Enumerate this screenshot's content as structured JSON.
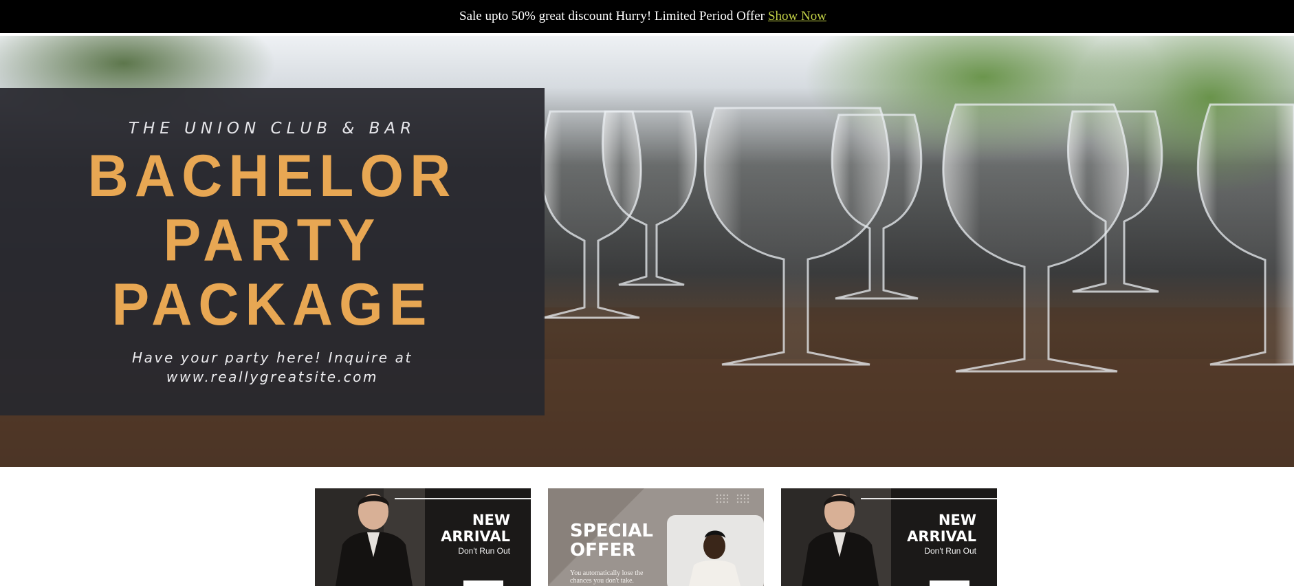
{
  "promo_bar": {
    "message": "Sale upto 50% great discount Hurry! Limited Period Offer",
    "link_label": "Show Now",
    "link_color": "#c2d146"
  },
  "hero": {
    "venue": "THE UNION CLUB & BAR",
    "headline": [
      "BACHELOR",
      "PARTY",
      "PACKAGE"
    ],
    "tagline_line1": "Have your party here! Inquire at",
    "tagline_line2": "www.reallygreatsite.com",
    "accent_color": "#e8a753"
  },
  "cards": [
    {
      "title_line1": "NEW",
      "title_line2": "ARRIVAL",
      "subtitle": "Don't Run Out"
    },
    {
      "title_line1": "SPECIAL",
      "title_line2": "OFFER",
      "subtitle": "You automatically lose the chances you don't take."
    },
    {
      "title_line1": "NEW",
      "title_line2": "ARRIVAL",
      "subtitle": "Don't Run Out"
    }
  ]
}
